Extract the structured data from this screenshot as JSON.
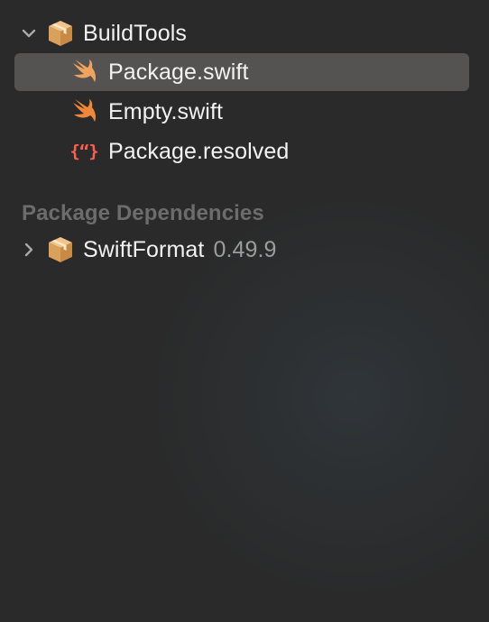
{
  "navigator": {
    "root": {
      "name": "BuildTools",
      "icon": "package-icon",
      "expanded": true,
      "files": [
        {
          "name": "Package.swift",
          "icon": "swift-icon",
          "selected": true
        },
        {
          "name": "Empty.swift",
          "icon": "swift-icon",
          "selected": false
        },
        {
          "name": "Package.resolved",
          "icon": "json-braces-icon",
          "selected": false
        }
      ]
    },
    "dependencies": {
      "header": "Package Dependencies",
      "items": [
        {
          "name": "SwiftFormat",
          "version": "0.49.9",
          "icon": "package-icon",
          "expanded": false
        }
      ]
    }
  },
  "colors": {
    "background": "#2a2a2a",
    "selection": "#545351",
    "swift_orange": "#f0883a",
    "json_red": "#ff5f4d",
    "package_tan": "#e3ae6c"
  }
}
